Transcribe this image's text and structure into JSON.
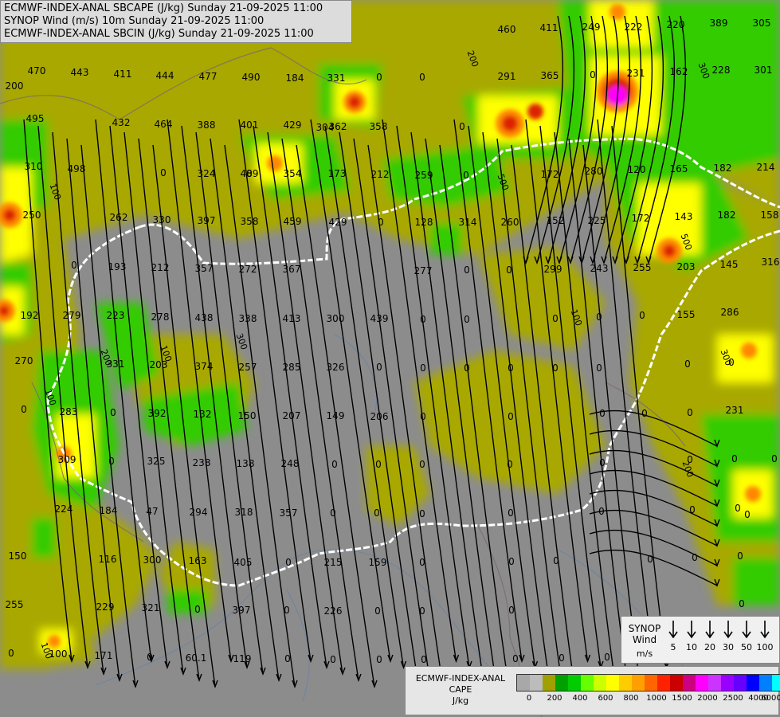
{
  "title_lines": [
    "ECMWF-INDEX-ANAL SBCAPE (J/kg) Sunday 21-09-2025 11:00",
    "SYNOP Wind (m/s) 10m Sunday 21-09-2025 11:00",
    "ECMWF-INDEX-ANAL SBCIN (J/kg) Sunday 21-09-2025 11:00"
  ],
  "synop_legend": {
    "label_line1": "SYNOP",
    "label_line2": "Wind",
    "units": "m/s",
    "speeds": [
      "5",
      "10",
      "20",
      "30",
      "50",
      "100"
    ]
  },
  "cape_legend": {
    "title_line1": "ECMWF-INDEX-ANAL",
    "title_line2": "CAPE",
    "units": "J/kg",
    "colors": [
      "#a8a8a8",
      "#bcbcbc",
      "#a0a000",
      "#00a000",
      "#00cc00",
      "#66ff00",
      "#ccff00",
      "#ffff00",
      "#ffcc00",
      "#ffa000",
      "#ff6600",
      "#ff2200",
      "#cc0000",
      "#cc0080",
      "#ff00ff",
      "#cc33ff",
      "#9900ff",
      "#6600ff",
      "#0000ff",
      "#0080ff",
      "#00ffff",
      "#ffffff"
    ],
    "ticks": [
      "0",
      "200",
      "400",
      "600",
      "800",
      "1000",
      "1500",
      "2000",
      "2500",
      "4000",
      "6000"
    ]
  },
  "value_labels": [
    "470",
    "443",
    "411",
    "444",
    "477",
    "490",
    "184",
    "331",
    "0",
    "0",
    "460",
    "411",
    "249",
    "222",
    "220",
    "389",
    "305",
    "200",
    "495",
    "432",
    "464",
    "388",
    "401",
    "429",
    "304",
    "362",
    "358",
    "0",
    "291",
    "365",
    "0",
    "231",
    "162",
    "228",
    "301",
    "310",
    "498",
    "0",
    "324",
    "489",
    "0",
    "354",
    "173",
    "212",
    "259",
    "0",
    "172",
    "280",
    "120",
    "165",
    "182",
    "214",
    "250",
    "262",
    "330",
    "397",
    "358",
    "459",
    "429",
    "0",
    "128",
    "314",
    "260",
    "152",
    "225",
    "172",
    "143",
    "182",
    "158",
    "0",
    "193",
    "212",
    "357",
    "272",
    "367",
    "277",
    "0",
    "0",
    "299",
    "243",
    "255",
    "203",
    "145",
    "316",
    "192",
    "279",
    "223",
    "278",
    "438",
    "338",
    "413",
    "300",
    "439",
    "0",
    "0",
    "0",
    "0",
    "0",
    "155",
    "286",
    "270",
    "331",
    "203",
    "374",
    "257",
    "285",
    "326",
    "0",
    "0",
    "0",
    "0",
    "0",
    "0",
    "0",
    "0",
    "0",
    "283",
    "0",
    "392",
    "132",
    "150",
    "207",
    "149",
    "206",
    "0",
    "0",
    "0",
    "0",
    "0",
    "231",
    "309",
    "0",
    "325",
    "238",
    "138",
    "248",
    "0",
    "0",
    "0",
    "0",
    "0",
    "0",
    "0",
    "0",
    "224",
    "184",
    "47",
    "294",
    "318",
    "357",
    "0",
    "0",
    "0",
    "0",
    "0",
    "0",
    "0",
    "0",
    "150",
    "116",
    "300",
    "163",
    "405",
    "0",
    "215",
    "159",
    "0",
    "0",
    "0",
    "0",
    "0",
    "0",
    "255",
    "229",
    "321",
    "0",
    "397",
    "0",
    "226",
    "0",
    "0",
    "0",
    "0",
    "0",
    "100",
    "171",
    "0",
    "60.1",
    "119",
    "0",
    "0",
    "0",
    "0",
    "0",
    "0",
    "0",
    "0",
    "0",
    "0"
  ],
  "contour_labels": [
    "100",
    "200",
    "300",
    "500",
    "100",
    "200",
    "300",
    "100",
    "200",
    "500",
    "100",
    "300",
    "100"
  ]
}
